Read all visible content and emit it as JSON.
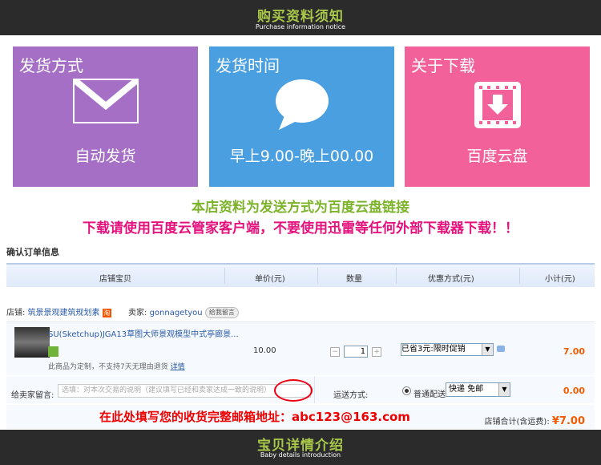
{
  "top_banner": {
    "title": "购买资料须知",
    "subtitle": "Purchase information notice"
  },
  "cards": [
    {
      "heading": "发货方式",
      "body": "自动发货",
      "icon": "envelope-icon",
      "color": "#a56fc6"
    },
    {
      "heading": "发货时间",
      "body": "早上9.00-晚上00.00",
      "icon": "speech-bubble-icon",
      "color": "#4a9fe0"
    },
    {
      "heading": "关于下载",
      "body": "百度云盘",
      "icon": "download-icon",
      "color": "#f2619a"
    }
  ],
  "notice": {
    "line1": "本店资料为发送方式为百度云盘链接",
    "line2": "下载请使用百度云管家客户端，不要使用迅雷等任何外部下载器下载！！"
  },
  "order": {
    "title": "确认订单信息",
    "columns": [
      "店铺宝贝",
      "单价(元)",
      "数量",
      "优惠方式(元)",
      "小计(元)"
    ],
    "shop_label": "店铺:",
    "shop_name": "筑景景观建筑规划素",
    "seller_label": "卖家:",
    "seller_id": "gonnagetyou",
    "message_button": "给我留言",
    "item": {
      "name": "SU(Sketchup)JGA13草图大师景观模型中式亭廊景...",
      "note": "此商品为定制，不支持7天无理由退货",
      "note_link": "详情",
      "price": "10.00",
      "quantity": "1",
      "discount": "已省3元:限时促销",
      "subtotal": "7.00"
    },
    "seller_message_label": "给卖家留言:",
    "seller_message_placeholder": "选填：对本次交易的说明（建议填写已经和卖家达成一致的说明）",
    "shipping_label": "运送方式:",
    "shipping_option": "普通配送",
    "shipping_select": "快递 免邮",
    "shipping_fee": "0.00",
    "fill_instruction": "在此处填写您的收货完整邮箱地址：abc123@163.com",
    "total_label": "店铺合计(含运费):",
    "total_value": "¥7.00"
  },
  "bottom_banner": {
    "title": "宝贝详情介绍",
    "subtitle": "Baby details introduction"
  }
}
